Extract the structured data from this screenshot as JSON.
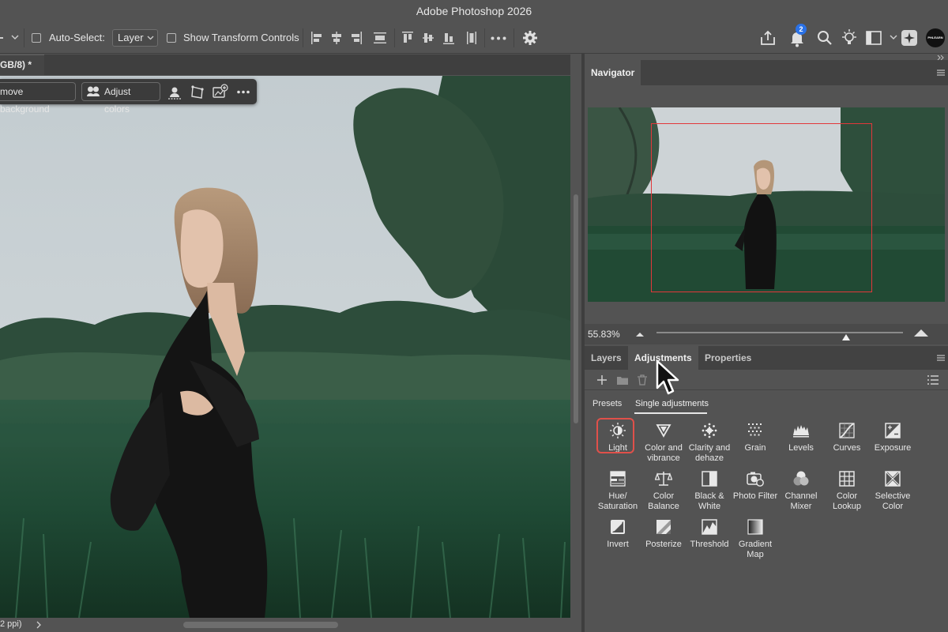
{
  "app": {
    "title": "Adobe Photoshop 2026"
  },
  "options_bar": {
    "auto_select_label": "Auto-Select:",
    "auto_select_value": "Layer",
    "show_transform_label": "Show Transform Controls",
    "notification_count": "2",
    "avatar_text": "PHLEARN"
  },
  "document": {
    "tab_label": "GB/8) *",
    "status_text": "2 ppi)"
  },
  "taskbar": {
    "remove_background": "move background",
    "adjust_colors": "Adjust colors"
  },
  "navigator": {
    "tab": "Navigator",
    "zoom": "55.83%",
    "zoom_level": 0.77
  },
  "adjustments_panel": {
    "tabs": [
      "Layers",
      "Adjustments",
      "Properties"
    ],
    "active_tab": "Adjustments",
    "subtabs": [
      "Presets",
      "Single adjustments"
    ],
    "active_subtab": "Single adjustments",
    "highlight_color": "#e0504a",
    "items": [
      {
        "line1": "Light",
        "line2": "",
        "icon": "light-icon"
      },
      {
        "line1": "Color and",
        "line2": "vibrance",
        "icon": "color-vibrance-icon"
      },
      {
        "line1": "Clarity and",
        "line2": "dehaze",
        "icon": "clarity-dehaze-icon"
      },
      {
        "line1": "Grain",
        "line2": "",
        "icon": "grain-icon"
      },
      {
        "line1": "Levels",
        "line2": "",
        "icon": "levels-icon"
      },
      {
        "line1": "Curves",
        "line2": "",
        "icon": "curves-icon"
      },
      {
        "line1": "Exposure",
        "line2": "",
        "icon": "exposure-icon"
      },
      {
        "line1": "Hue/",
        "line2": "Saturation",
        "icon": "hue-saturation-icon"
      },
      {
        "line1": "Color",
        "line2": "Balance",
        "icon": "color-balance-icon"
      },
      {
        "line1": "Black &",
        "line2": "White",
        "icon": "black-white-icon"
      },
      {
        "line1": "Photo Filter",
        "line2": "",
        "icon": "photo-filter-icon"
      },
      {
        "line1": "Channel",
        "line2": "Mixer",
        "icon": "channel-mixer-icon"
      },
      {
        "line1": "Color",
        "line2": "Lookup",
        "icon": "color-lookup-icon"
      },
      {
        "line1": "Selective",
        "line2": "Color",
        "icon": "selective-color-icon"
      },
      {
        "line1": "Invert",
        "line2": "",
        "icon": "invert-icon"
      },
      {
        "line1": "Posterize",
        "line2": "",
        "icon": "posterize-icon"
      },
      {
        "line1": "Threshold",
        "line2": "",
        "icon": "threshold-icon"
      },
      {
        "line1": "Gradient",
        "line2": "Map",
        "icon": "gradient-map-icon"
      }
    ]
  }
}
